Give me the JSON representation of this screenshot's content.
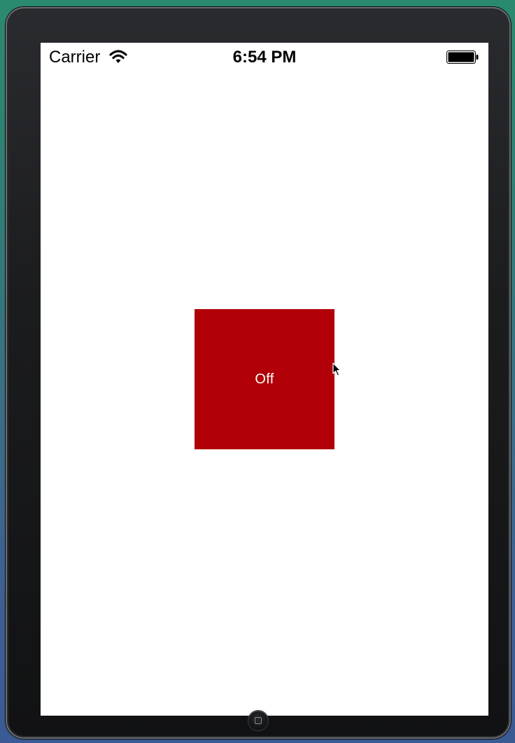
{
  "status_bar": {
    "carrier": "Carrier",
    "time": "6:54 PM",
    "wifi_icon": "wifi-icon",
    "battery_icon": "battery-icon"
  },
  "main": {
    "toggle_label": "Off",
    "toggle_color": "#b10008"
  },
  "device": {
    "home_icon": "home-button-icon"
  }
}
